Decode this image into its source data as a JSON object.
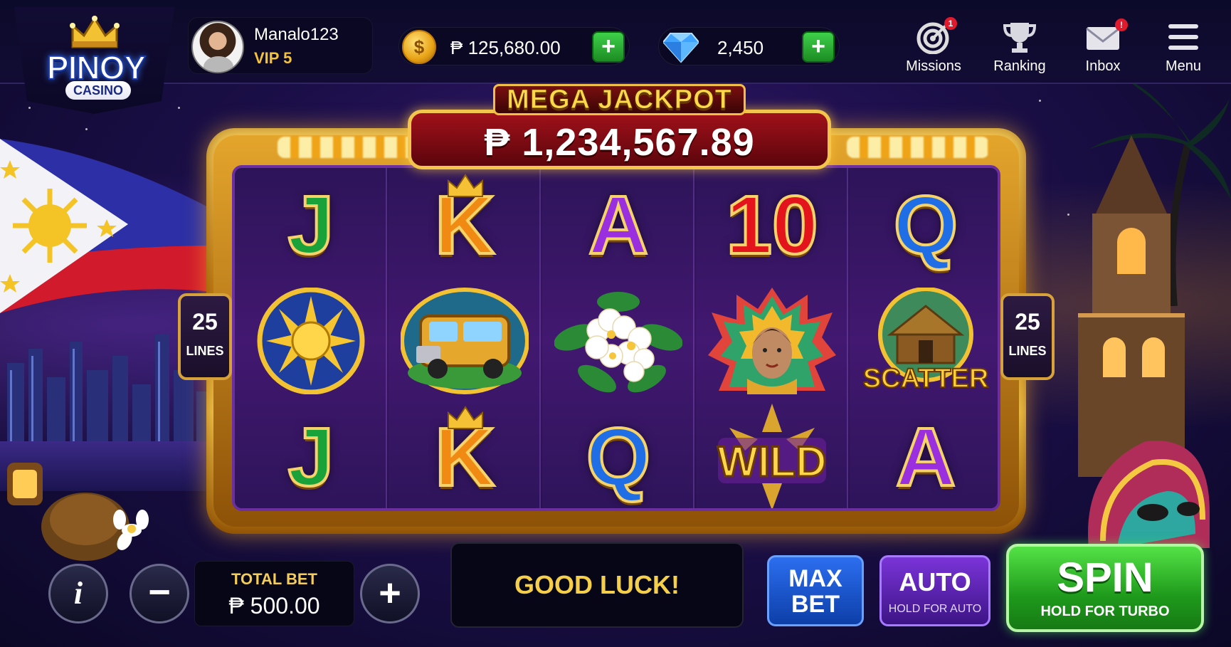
{
  "brand": {
    "logo_main": "PINOY",
    "logo_sub": "CASINO"
  },
  "profile": {
    "username": "Manalo123",
    "vip": "VIP 5"
  },
  "currency": {
    "coins": "₱ 125,680.00",
    "coins_icon_glyph": "$",
    "gems": "2,450",
    "plus_label": "+"
  },
  "nav": [
    {
      "label": "Missions",
      "icon": "target-icon",
      "badge": "1"
    },
    {
      "label": "Ranking",
      "icon": "trophy-icon"
    },
    {
      "label": "Inbox",
      "icon": "envelope-icon",
      "badge": "!"
    },
    {
      "label": "Menu",
      "icon": "hamburger-icon"
    }
  ],
  "jackpot": {
    "title": "MEGA JACKPOT",
    "value": "₱ 1,234,567.89"
  },
  "paylines": {
    "left_count": "25",
    "right_count": "25",
    "label": "LINES"
  },
  "reels": [
    [
      "J",
      "sun-symbol",
      "J"
    ],
    [
      "K",
      "jeepney-symbol",
      "K"
    ],
    [
      "A",
      "sampaguita-flower-symbol",
      "Q"
    ],
    [
      "10",
      "festival-dancer-symbol",
      "wild-symbol"
    ],
    [
      "Q",
      "scatter-nipa-hut-symbol",
      "A"
    ]
  ],
  "symbol_text": {
    "wild": "WILD",
    "scatter": "SCATTER"
  },
  "controls": {
    "info": "i",
    "minus": "−",
    "plus": "+",
    "total_bet_label": "TOTAL BET",
    "total_bet_value": "₱ 500.00",
    "message": "GOOD LUCK!",
    "max_bet_line1": "MAX",
    "max_bet_line2": "BET",
    "auto_label": "AUTO",
    "auto_sub": "HOLD FOR AUTO",
    "spin_label": "SPIN",
    "spin_sub": "HOLD FOR TURBO"
  },
  "colors": {
    "gold": "#f3c54d",
    "spin_green": "#1f9a1c",
    "max_bet_blue": "#2c6ef0",
    "auto_purple": "#7a34d8",
    "jackpot_red": "#a0111a"
  }
}
